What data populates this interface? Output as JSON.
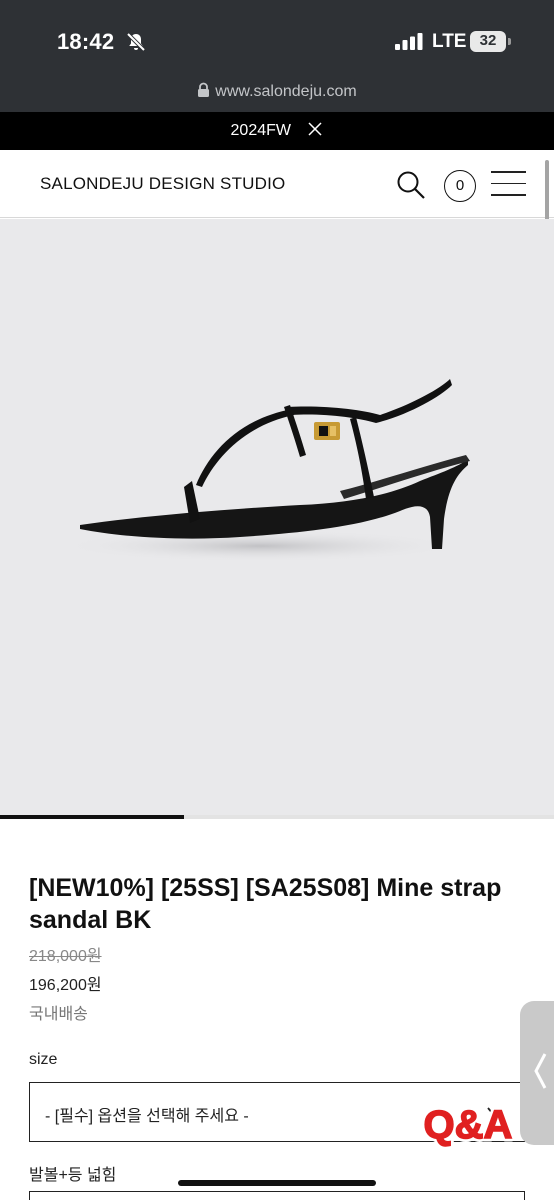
{
  "status_bar": {
    "time": "18:42",
    "carrier": "LTE",
    "battery": "32",
    "icons": [
      "bell-slash-icon",
      "signal-bars-icon",
      "battery-icon"
    ]
  },
  "browser": {
    "url": "www.salondeju.com",
    "icons": [
      "lock-icon"
    ]
  },
  "promo": {
    "text": "2024FW",
    "icons": [
      "close-icon"
    ]
  },
  "header": {
    "brand": "SALONDEJU DESIGN STUDIO",
    "cart_count": "0",
    "icons": [
      "search-icon",
      "cart-count-icon",
      "hamburger-menu-icon"
    ]
  },
  "gallery": {
    "slide_progress": 0.333,
    "image": "black strap sandal with gold buckle"
  },
  "product": {
    "title": "[NEW10%] [25SS] [SA25S08] Mine strap sandal BK",
    "original_price": "218,000원",
    "sale_price": "196,200원",
    "shipping": "국내배송"
  },
  "options": {
    "size_label": "size",
    "size_select_value": "- [필수] 옵션을 선택해 주세요 -",
    "width_label": "발볼+등 넓힘"
  },
  "floating": {
    "qa_text": "Q&A",
    "icons": [
      "chevron-left-icon"
    ]
  },
  "colors": {
    "status_bar_bg": "#2e3135",
    "promo_bg": "#000000",
    "hero_bg": "#e9e9eb",
    "qa_red": "#e02020",
    "side_tab": "#c9c9c9"
  }
}
